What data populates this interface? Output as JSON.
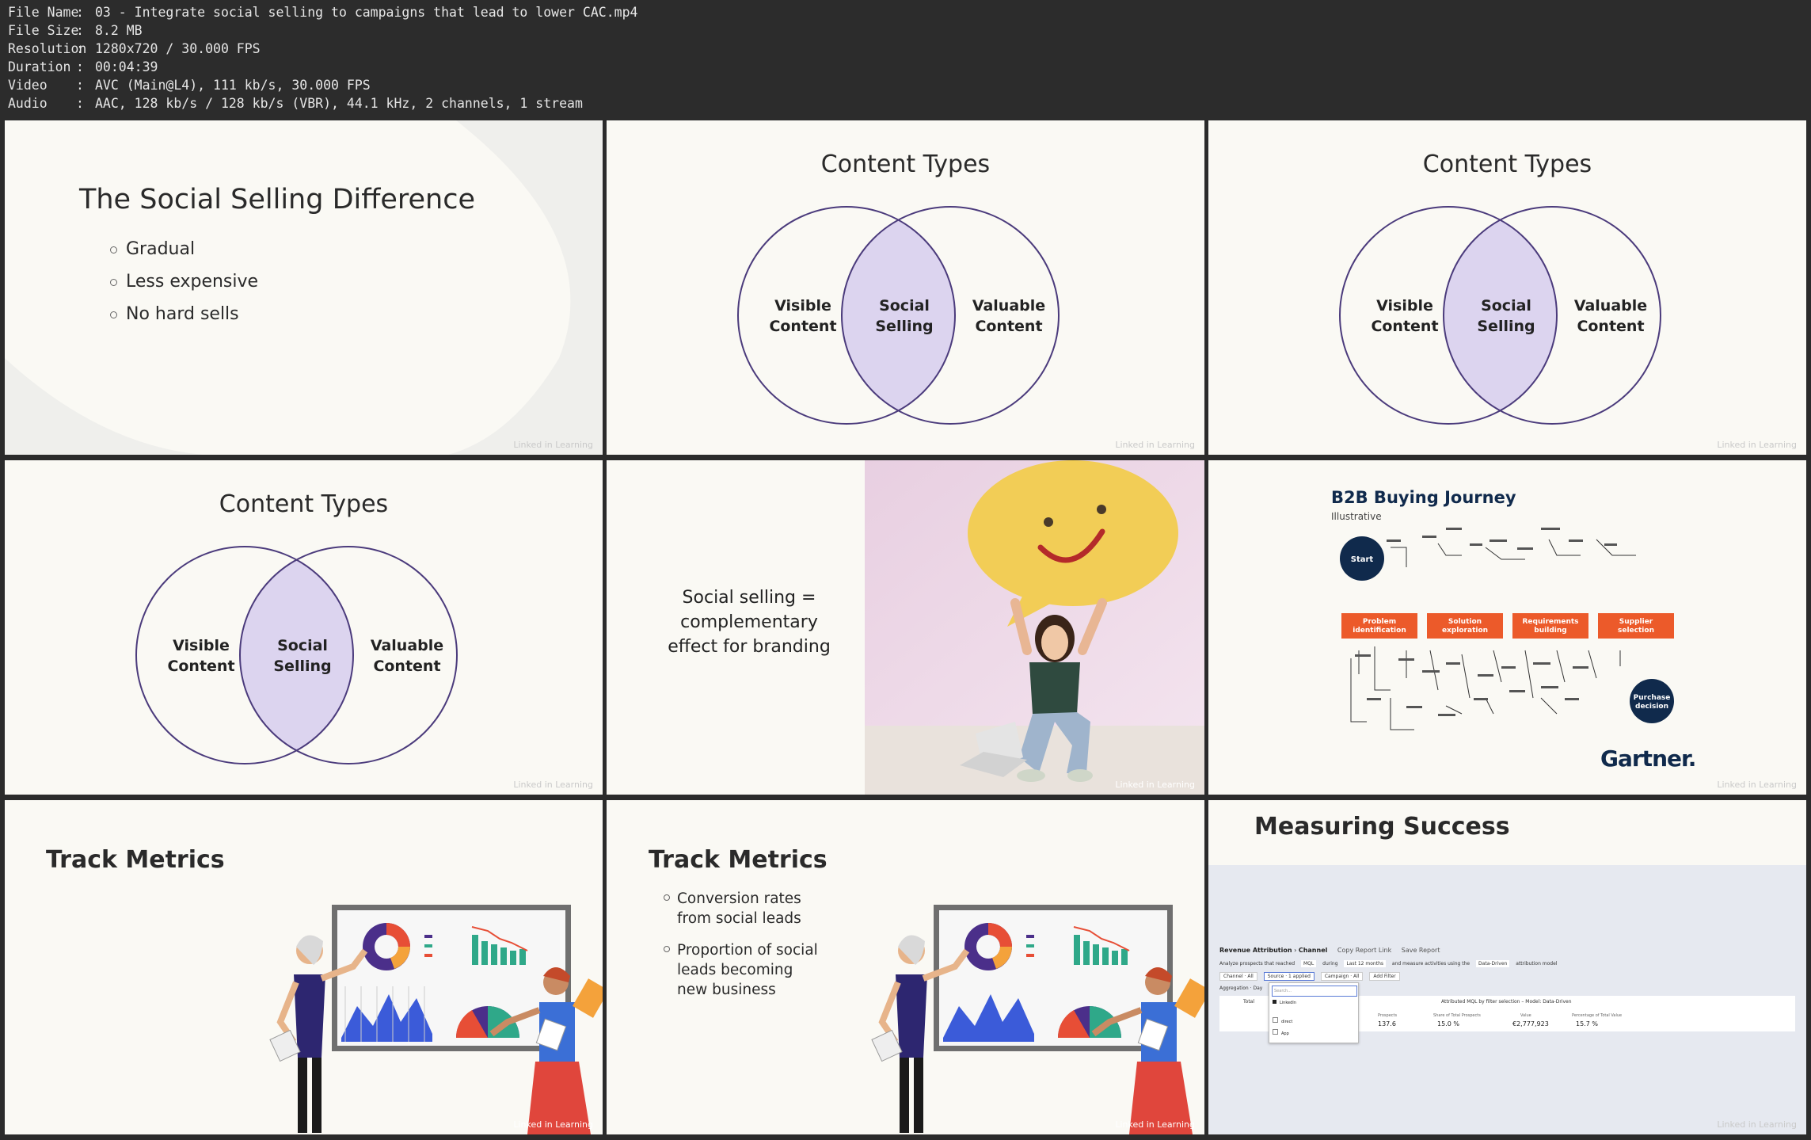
{
  "file_info": {
    "rows": [
      {
        "key": "File Name",
        "sep": ":",
        "value": "03 - Integrate social selling to campaigns that lead to lower CAC.mp4"
      },
      {
        "key": "File Size",
        "sep": ":",
        "value": "8.2 MB"
      },
      {
        "key": "Resolution",
        "sep": ":",
        "value": "1280x720 / 30.000 FPS"
      },
      {
        "key": "Duration",
        "sep": ":",
        "value": "00:04:39"
      },
      {
        "key": "Video",
        "sep": ":",
        "value": "AVC (Main@L4), 111 kb/s, 30.000 FPS"
      },
      {
        "key": "Audio",
        "sep": ":",
        "value": "AAC, 128 kb/s / 128 kb/s (VBR), 44.1 kHz, 2 channels, 1 stream"
      }
    ]
  },
  "watermark": "Linked in Learning",
  "slide1": {
    "title": "The Social Selling Difference",
    "bullets": [
      "Gradual",
      "Less expensive",
      "No hard sells"
    ]
  },
  "venn": {
    "title": "Content Types",
    "left": [
      "Visible",
      "Content"
    ],
    "center": [
      "Social",
      "Selling"
    ],
    "right": [
      "Valuable",
      "Content"
    ]
  },
  "slide5": {
    "lines": [
      "Social selling =",
      "complementary",
      "effect for branding"
    ]
  },
  "slide6": {
    "title": "B2B Buying Journey",
    "subtitle": "Illustrative",
    "start": "Start",
    "end": [
      "Purchase",
      "decision"
    ],
    "stages": [
      [
        "Problem",
        "identification"
      ],
      [
        "Solution",
        "exploration"
      ],
      [
        "Requirements",
        "building"
      ],
      [
        "Supplier",
        "selection"
      ]
    ],
    "brand": "Gartner."
  },
  "slide7": {
    "title": "Track Metrics"
  },
  "slide8": {
    "title": "Track Metrics",
    "bullets": [
      [
        "Conversion rates",
        "from social leads"
      ],
      [
        "Proportion of social",
        "leads becoming",
        "new business"
      ]
    ]
  },
  "slide9": {
    "title": "Measuring Success",
    "report": {
      "heading": "Revenue Attribution",
      "crumb": "Channel",
      "copy_link": "Copy Report Link",
      "save": "Save Report",
      "line1": [
        "Analyze prospects that reached",
        "MQL",
        "during",
        "Last 12 months",
        "and measure activities using the",
        "Data-Driven",
        "attribution model"
      ],
      "filters": [
        "Channel · All",
        "Source · 1 applied",
        "Campaign · All",
        "Add Filter"
      ],
      "aggregation": "Aggregation · Day",
      "search_placeholder": "Search...",
      "options": [
        "LinkedIn",
        "direct",
        "App"
      ],
      "table_caption": "Attributed MQL by filter selection – Model: Data-Driven",
      "total_label": "Total",
      "columns": [
        "Prospects",
        "Share of Total Prospects",
        "Value",
        "Percentage of Total Value"
      ],
      "values": [
        "137.6",
        "15.0 %",
        "€2,777,923",
        "15.7 %"
      ]
    }
  },
  "colors": {
    "venn_stroke": "#4b3b7c",
    "venn_fill": "#dcd4ef",
    "orange": "#ec5a2a",
    "navy": "#102a4c"
  }
}
